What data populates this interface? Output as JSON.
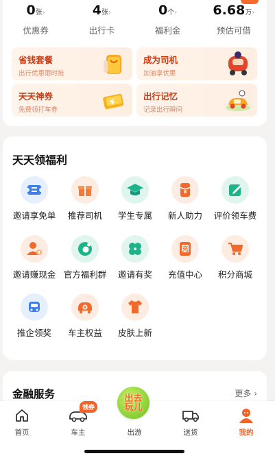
{
  "stats": [
    {
      "value": "0",
      "unit": "张",
      "label": "优惠券"
    },
    {
      "value": "4",
      "unit": "张",
      "label": "出行卡"
    },
    {
      "value": "0",
      "unit": "个",
      "label": "福利金"
    },
    {
      "value": "6.68",
      "unit": "万",
      "label": "预估可借"
    }
  ],
  "promos": [
    {
      "title": "省钱套餐",
      "subtitle": "出行优惠限时抢",
      "icon": "shopping-bag-icon"
    },
    {
      "title": "成为司机",
      "subtitle": "加油享优惠",
      "icon": "driver-car-icon"
    },
    {
      "title": "天天神券",
      "subtitle": "免费领打车券",
      "icon": "coupon-icon"
    },
    {
      "title": "出行记忆",
      "subtitle": "记录出行瞬间",
      "icon": "travel-car-icon"
    }
  ],
  "welfare": {
    "title": "天天领福利",
    "items": [
      {
        "label": "邀请享免单",
        "icon": "ticket-icon"
      },
      {
        "label": "推荐司机",
        "icon": "gift-box-icon"
      },
      {
        "label": "学生专属",
        "icon": "graduation-cap-icon"
      },
      {
        "label": "新人助力",
        "icon": "red-envelope-icon"
      },
      {
        "label": "评价领车费",
        "icon": "review-edit-icon"
      },
      {
        "label": "邀请赚现金",
        "icon": "invite-user-icon"
      },
      {
        "label": "官方福利群",
        "icon": "chat-group-icon"
      },
      {
        "label": "邀请有奖",
        "icon": "clover-icon"
      },
      {
        "label": "充值中心",
        "icon": "recharge-icon",
        "glyph": "充"
      },
      {
        "label": "积分商城",
        "icon": "shopping-cart-icon"
      },
      {
        "label": "推企领奖",
        "icon": "business-car-icon"
      },
      {
        "label": "车主权益",
        "icon": "car-owner-icon"
      },
      {
        "label": "皮肤上新",
        "icon": "tshirt-icon"
      }
    ]
  },
  "finance": {
    "title": "金融服务",
    "more": "更多"
  },
  "tabbar": {
    "items": [
      {
        "label": "首页",
        "icon": "home-icon"
      },
      {
        "label": "车主",
        "icon": "car-outline-icon",
        "badge": "领券"
      },
      {
        "label": "出游",
        "icon": "travel-logo-icon",
        "logo_text": "出去玩儿"
      },
      {
        "label": "送货",
        "icon": "truck-icon"
      },
      {
        "label": "我的",
        "icon": "profile-icon"
      }
    ]
  },
  "colors": {
    "accent": "#f06428",
    "promo_title": "#c93c14",
    "logo_green": "#6cc020"
  }
}
